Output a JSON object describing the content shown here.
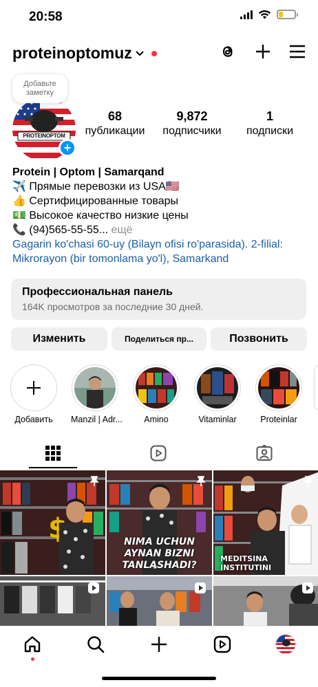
{
  "status_bar": {
    "time": "20:58",
    "battery_level": 0.25,
    "battery_color": "#f5c400"
  },
  "header": {
    "username": "proteinoptomuz",
    "icons": [
      "threads-icon",
      "plus-icon",
      "menu-icon"
    ],
    "notification_dot_color": "#ff3040"
  },
  "note": {
    "placeholder": "Добавьте заметку"
  },
  "stats": [
    {
      "value": "68",
      "label": "публикации"
    },
    {
      "value": "9,872",
      "label": "подписчики"
    },
    {
      "value": "1",
      "label": "подписки"
    }
  ],
  "bio": {
    "name": "Protein | Optom | Samarqand",
    "line1": "Прямые перевозки из USA",
    "line2": "Сертифицированные товары",
    "line3": "Высокое качество низкие цены",
    "phone": "(94)565-55-55...",
    "more": " ещё",
    "address": "Gagarin ko'chasi 60-uy (Bilayn ofisi ro'parasida). 2-filial: Mikrorayon (bir tomonlama yo'l), Samarkand"
  },
  "pro_panel": {
    "title": "Профессиональная панель",
    "subtitle": "164K просмотров за последние 30 дней."
  },
  "buttons": {
    "edit": "Изменить",
    "share": "Поделиться пр...",
    "call": "Позвонить"
  },
  "highlights": [
    {
      "label": "Добавить"
    },
    {
      "label": "Manzil | Adr..."
    },
    {
      "label": "Amino"
    },
    {
      "label": "Vitaminlar"
    },
    {
      "label": "Proteinlar"
    }
  ],
  "tabs": [
    "grid-icon",
    "reels-icon",
    "tagged-icon"
  ],
  "grid": {
    "post_texts": {
      "p2": "NIMA UCHUN AYNAN BIZNI TANLASHADI?",
      "p3": "MEDITSINA INSTITUTINI"
    }
  },
  "avatar_text": "PROTEINOPTOM",
  "colors": {
    "accent": "#0095f6",
    "link": "#1a5fa8",
    "panel_bg": "#efefef"
  }
}
